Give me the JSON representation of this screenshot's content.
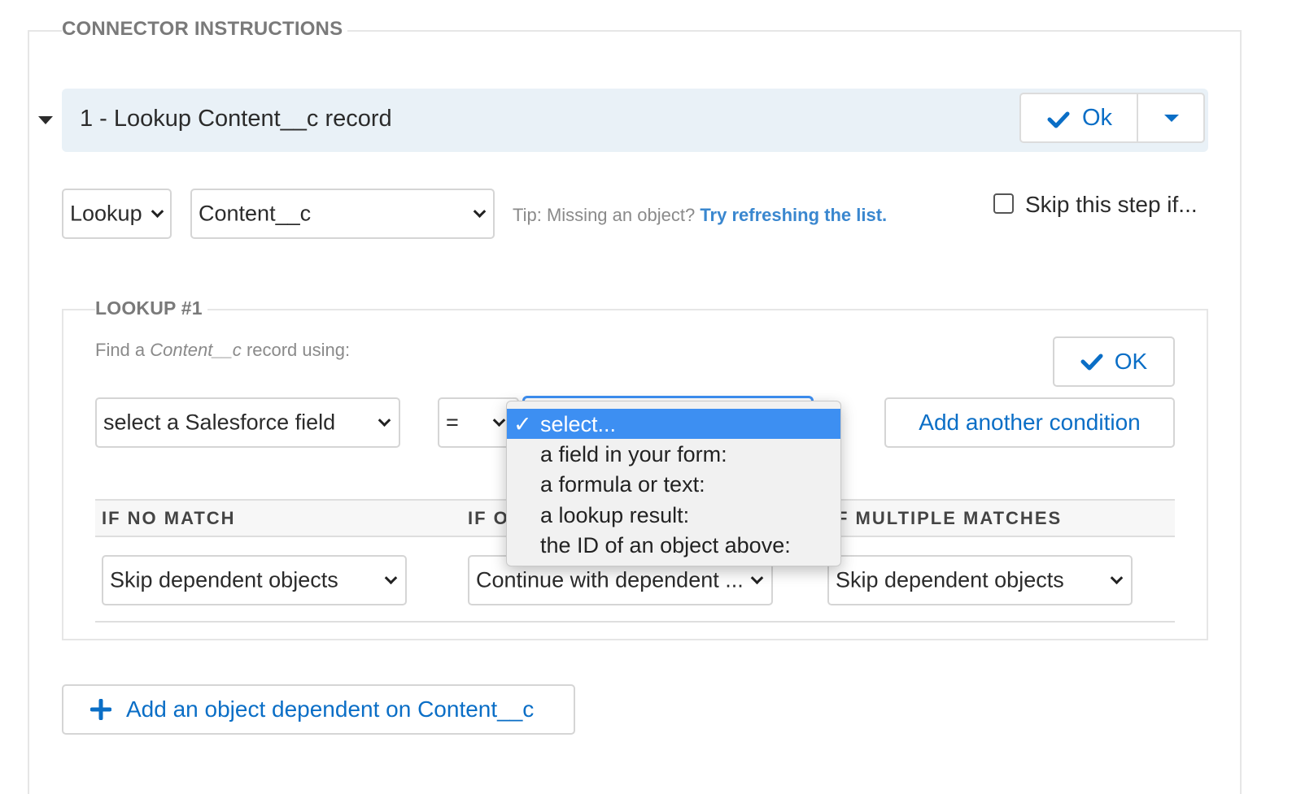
{
  "section_title": "CONNECTOR INSTRUCTIONS",
  "step": {
    "title": "1 - Lookup Content__c record",
    "ok_label": "Ok"
  },
  "action_select": {
    "value": "Lookup"
  },
  "object_select": {
    "value": "Content__c"
  },
  "tip": {
    "prefix": "Tip: Missing an object?",
    "link": "Try refreshing the list."
  },
  "skip_step": {
    "label": "Skip this step if...",
    "checked": false
  },
  "lookup": {
    "legend": "LOOKUP #1",
    "find_prefix": "Find a",
    "find_object": "Content__c",
    "find_suffix": "record using:",
    "ok_label": "OK",
    "field_select": "select a Salesforce field",
    "operator_select": "=",
    "add_condition_label": "Add another condition",
    "value_options": [
      {
        "label": "select...",
        "selected": true
      },
      {
        "label": "a field in your form:",
        "selected": false
      },
      {
        "label": "a formula or text:",
        "selected": false
      },
      {
        "label": "a lookup result:",
        "selected": false
      },
      {
        "label": "the ID of an object above:",
        "selected": false
      }
    ],
    "checkmark": "✓",
    "headers": {
      "no_match": "IF NO MATCH",
      "one_match": "IF O",
      "multiple": "F MULTIPLE MATCHES"
    },
    "no_match_select": "Skip dependent objects",
    "one_match_select": "Continue with dependent ...",
    "multiple_select": "Skip dependent objects"
  },
  "add_dependent_label": "Add an object dependent on Content__c",
  "colors": {
    "accent": "#0a6ec6",
    "selected_option": "#3d8ff2",
    "header_bg": "#e9f1f7"
  }
}
